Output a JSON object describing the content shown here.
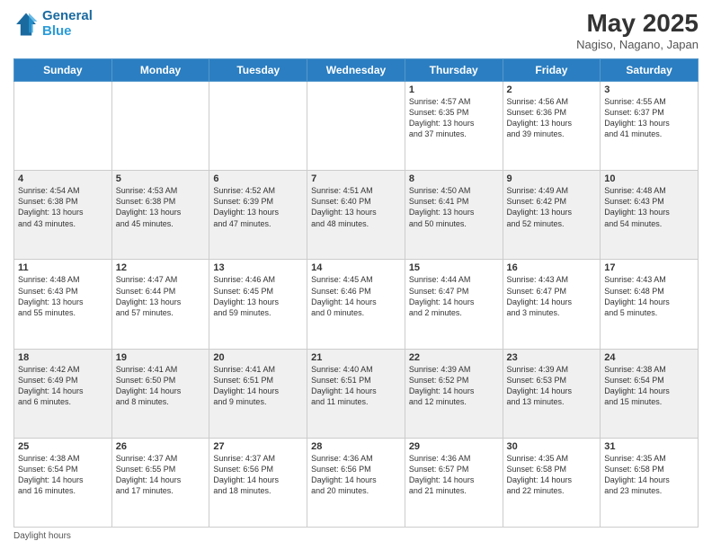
{
  "header": {
    "logo_line1": "General",
    "logo_line2": "Blue",
    "month": "May 2025",
    "location": "Nagiso, Nagano, Japan"
  },
  "days_of_week": [
    "Sunday",
    "Monday",
    "Tuesday",
    "Wednesday",
    "Thursday",
    "Friday",
    "Saturday"
  ],
  "weeks": [
    [
      {
        "day": "",
        "info": ""
      },
      {
        "day": "",
        "info": ""
      },
      {
        "day": "",
        "info": ""
      },
      {
        "day": "",
        "info": ""
      },
      {
        "day": "1",
        "info": "Sunrise: 4:57 AM\nSunset: 6:35 PM\nDaylight: 13 hours\nand 37 minutes."
      },
      {
        "day": "2",
        "info": "Sunrise: 4:56 AM\nSunset: 6:36 PM\nDaylight: 13 hours\nand 39 minutes."
      },
      {
        "day": "3",
        "info": "Sunrise: 4:55 AM\nSunset: 6:37 PM\nDaylight: 13 hours\nand 41 minutes."
      }
    ],
    [
      {
        "day": "4",
        "info": "Sunrise: 4:54 AM\nSunset: 6:38 PM\nDaylight: 13 hours\nand 43 minutes."
      },
      {
        "day": "5",
        "info": "Sunrise: 4:53 AM\nSunset: 6:38 PM\nDaylight: 13 hours\nand 45 minutes."
      },
      {
        "day": "6",
        "info": "Sunrise: 4:52 AM\nSunset: 6:39 PM\nDaylight: 13 hours\nand 47 minutes."
      },
      {
        "day": "7",
        "info": "Sunrise: 4:51 AM\nSunset: 6:40 PM\nDaylight: 13 hours\nand 48 minutes."
      },
      {
        "day": "8",
        "info": "Sunrise: 4:50 AM\nSunset: 6:41 PM\nDaylight: 13 hours\nand 50 minutes."
      },
      {
        "day": "9",
        "info": "Sunrise: 4:49 AM\nSunset: 6:42 PM\nDaylight: 13 hours\nand 52 minutes."
      },
      {
        "day": "10",
        "info": "Sunrise: 4:48 AM\nSunset: 6:43 PM\nDaylight: 13 hours\nand 54 minutes."
      }
    ],
    [
      {
        "day": "11",
        "info": "Sunrise: 4:48 AM\nSunset: 6:43 PM\nDaylight: 13 hours\nand 55 minutes."
      },
      {
        "day": "12",
        "info": "Sunrise: 4:47 AM\nSunset: 6:44 PM\nDaylight: 13 hours\nand 57 minutes."
      },
      {
        "day": "13",
        "info": "Sunrise: 4:46 AM\nSunset: 6:45 PM\nDaylight: 13 hours\nand 59 minutes."
      },
      {
        "day": "14",
        "info": "Sunrise: 4:45 AM\nSunset: 6:46 PM\nDaylight: 14 hours\nand 0 minutes."
      },
      {
        "day": "15",
        "info": "Sunrise: 4:44 AM\nSunset: 6:47 PM\nDaylight: 14 hours\nand 2 minutes."
      },
      {
        "day": "16",
        "info": "Sunrise: 4:43 AM\nSunset: 6:47 PM\nDaylight: 14 hours\nand 3 minutes."
      },
      {
        "day": "17",
        "info": "Sunrise: 4:43 AM\nSunset: 6:48 PM\nDaylight: 14 hours\nand 5 minutes."
      }
    ],
    [
      {
        "day": "18",
        "info": "Sunrise: 4:42 AM\nSunset: 6:49 PM\nDaylight: 14 hours\nand 6 minutes."
      },
      {
        "day": "19",
        "info": "Sunrise: 4:41 AM\nSunset: 6:50 PM\nDaylight: 14 hours\nand 8 minutes."
      },
      {
        "day": "20",
        "info": "Sunrise: 4:41 AM\nSunset: 6:51 PM\nDaylight: 14 hours\nand 9 minutes."
      },
      {
        "day": "21",
        "info": "Sunrise: 4:40 AM\nSunset: 6:51 PM\nDaylight: 14 hours\nand 11 minutes."
      },
      {
        "day": "22",
        "info": "Sunrise: 4:39 AM\nSunset: 6:52 PM\nDaylight: 14 hours\nand 12 minutes."
      },
      {
        "day": "23",
        "info": "Sunrise: 4:39 AM\nSunset: 6:53 PM\nDaylight: 14 hours\nand 13 minutes."
      },
      {
        "day": "24",
        "info": "Sunrise: 4:38 AM\nSunset: 6:54 PM\nDaylight: 14 hours\nand 15 minutes."
      }
    ],
    [
      {
        "day": "25",
        "info": "Sunrise: 4:38 AM\nSunset: 6:54 PM\nDaylight: 14 hours\nand 16 minutes."
      },
      {
        "day": "26",
        "info": "Sunrise: 4:37 AM\nSunset: 6:55 PM\nDaylight: 14 hours\nand 17 minutes."
      },
      {
        "day": "27",
        "info": "Sunrise: 4:37 AM\nSunset: 6:56 PM\nDaylight: 14 hours\nand 18 minutes."
      },
      {
        "day": "28",
        "info": "Sunrise: 4:36 AM\nSunset: 6:56 PM\nDaylight: 14 hours\nand 20 minutes."
      },
      {
        "day": "29",
        "info": "Sunrise: 4:36 AM\nSunset: 6:57 PM\nDaylight: 14 hours\nand 21 minutes."
      },
      {
        "day": "30",
        "info": "Sunrise: 4:35 AM\nSunset: 6:58 PM\nDaylight: 14 hours\nand 22 minutes."
      },
      {
        "day": "31",
        "info": "Sunrise: 4:35 AM\nSunset: 6:58 PM\nDaylight: 14 hours\nand 23 minutes."
      }
    ]
  ],
  "footer": {
    "note": "Daylight hours"
  }
}
